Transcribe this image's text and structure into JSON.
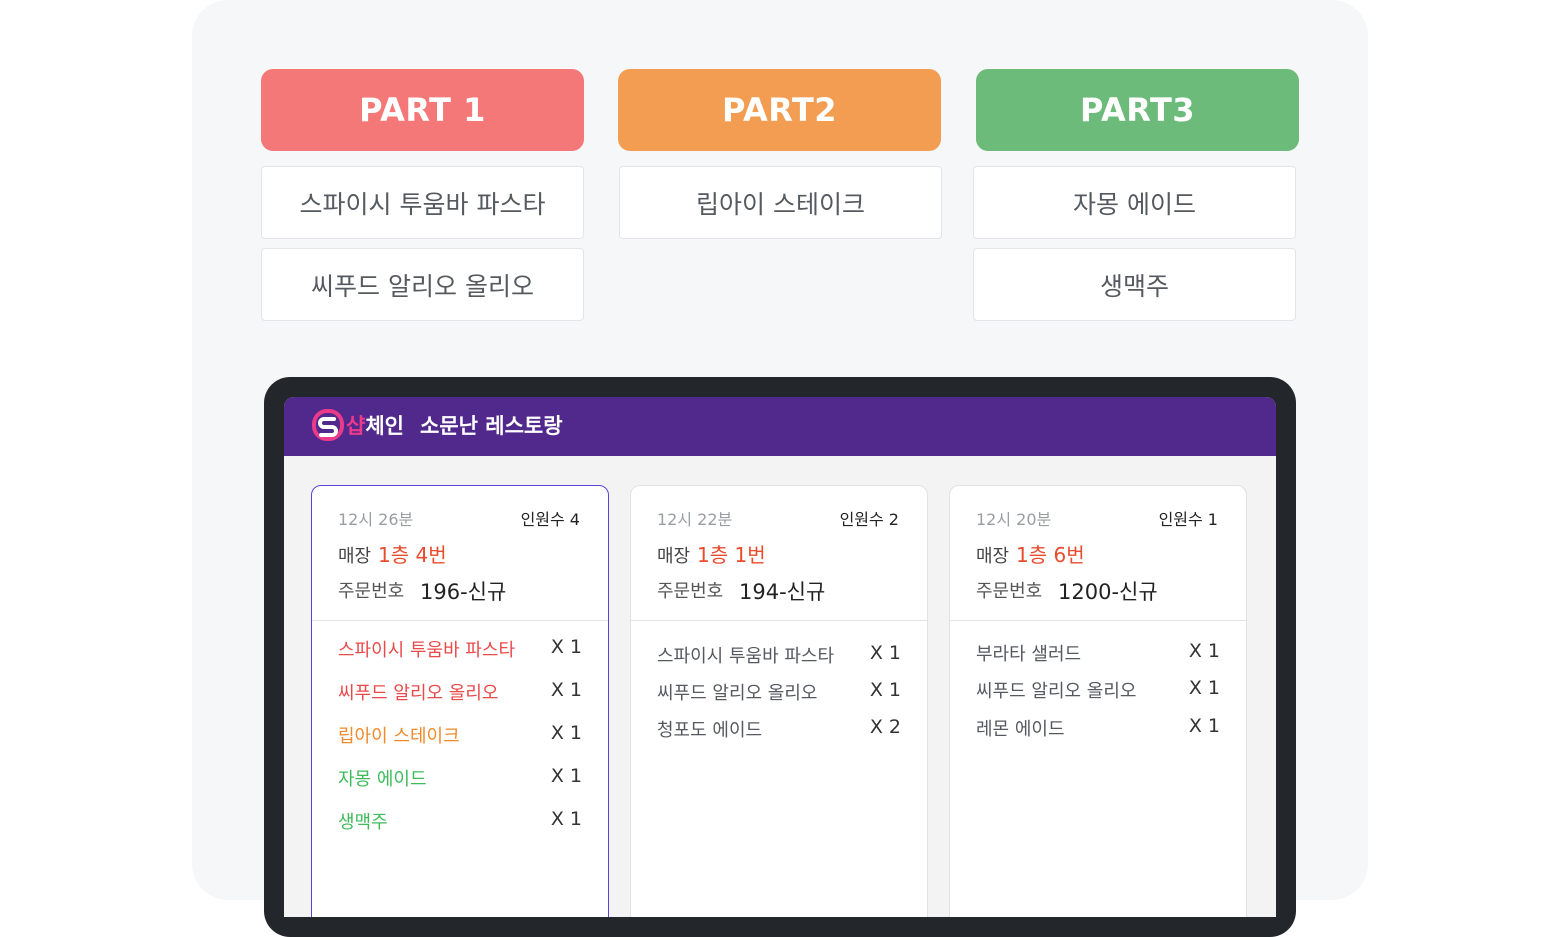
{
  "parts": [
    {
      "title": "PART 1",
      "color": "#f47878",
      "items": [
        "스파이시 투움바 파스타",
        "씨푸드 알리오 올리오"
      ]
    },
    {
      "title": "PART2",
      "color": "#f39d52",
      "items": [
        "립아이 스테이크"
      ]
    },
    {
      "title": "PART3",
      "color": "#6dbb7a",
      "items": [
        "자몽 에이드",
        "생맥주"
      ]
    }
  ],
  "app": {
    "brand_pink": "샵",
    "brand_white": "체인",
    "store_name": "소문난 레스토랑",
    "header_color": "#51288c"
  },
  "orders": [
    {
      "time": "12시 26분",
      "people": "인원수 4",
      "seat_label": "매장",
      "seat": "1층 4번",
      "order_label": "주문번호",
      "order_no": "196-신규",
      "items": [
        {
          "name": "스파이시 투움바 파스타",
          "qty": "X 1"
        },
        {
          "name": "씨푸드 알리오 올리오",
          "qty": "X 1"
        },
        {
          "name": "립아이 스테이크",
          "qty": "X 1"
        },
        {
          "name": "자몽 에이드",
          "qty": "X 1"
        },
        {
          "name": "생맥주",
          "qty": "X 1"
        }
      ]
    },
    {
      "time": "12시 22분",
      "people": "인원수 2",
      "seat_label": "매장",
      "seat": "1층 1번",
      "order_label": "주문번호",
      "order_no": "194-신규",
      "items": [
        {
          "name": "스파이시 투움바 파스타",
          "qty": "X 1"
        },
        {
          "name": "씨푸드 알리오 올리오",
          "qty": "X 1"
        },
        {
          "name": "청포도 에이드",
          "qty": "X 2"
        }
      ]
    },
    {
      "time": "12시 20분",
      "people": "인원수 1",
      "seat_label": "매장",
      "seat": "1층 6번",
      "order_label": "주문번호",
      "order_no": "1200-신규",
      "items": [
        {
          "name": "부라타 샐러드",
          "qty": "X 1"
        },
        {
          "name": "씨푸드 알리오 올리오",
          "qty": "X 1"
        },
        {
          "name": "레몬 에이드",
          "qty": "X 1"
        }
      ]
    }
  ],
  "colors": {
    "part1_item": "#e84a4a",
    "part2_item": "#f08a2a",
    "part3_item": "#3dbb5a",
    "neutral_item": "#555a60"
  }
}
